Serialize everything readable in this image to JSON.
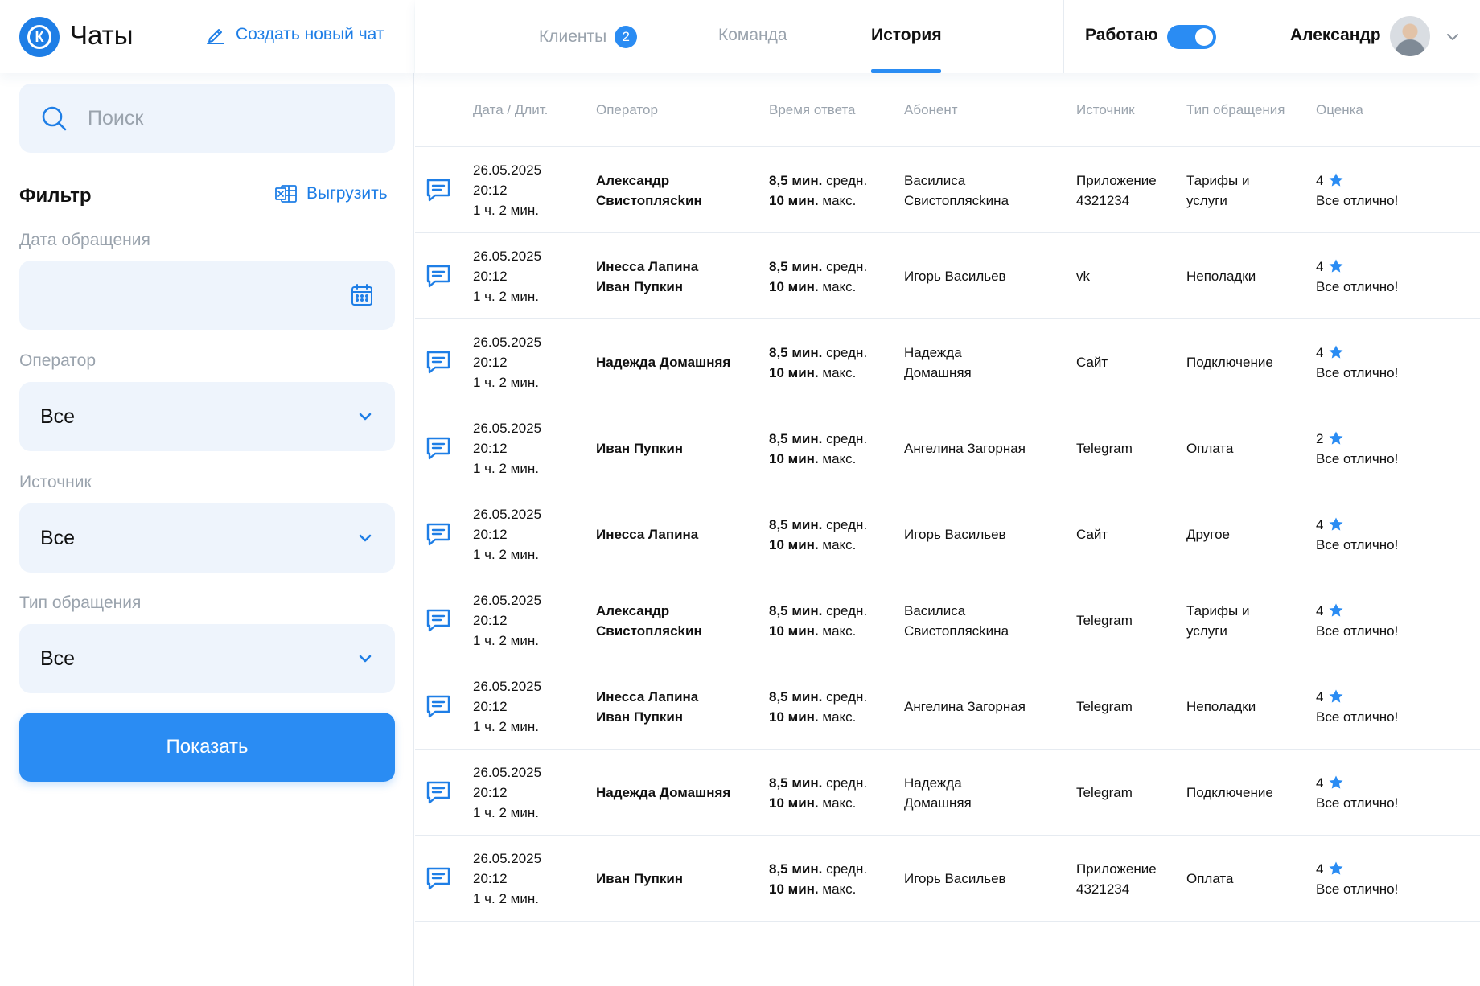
{
  "app": {
    "logo_letter": "К",
    "title": "Чаты",
    "new_chat_label": "Создать новый чат"
  },
  "search": {
    "placeholder": "Поиск"
  },
  "filter": {
    "title": "Фильтр",
    "export_label": "Выгрузить",
    "date_label": "Дата обращения",
    "operator_label": "Оператор",
    "operator_value": "Все",
    "source_label": "Источник",
    "source_value": "Все",
    "type_label": "Тип обращения",
    "type_value": "Все",
    "show_button": "Показать"
  },
  "tabs": [
    {
      "label": "Клиенты",
      "badge": "2"
    },
    {
      "label": "Команда"
    },
    {
      "label": "История",
      "active": true
    }
  ],
  "status": {
    "label": "Работаю",
    "toggle_on": true
  },
  "user": {
    "name": "Александр"
  },
  "colors": {
    "accent": "#2a8cf3",
    "field_bg": "#eef4fc",
    "muted_text": "#9aa3ad"
  },
  "table": {
    "columns": [
      "Дата / Длит.",
      "Оператор",
      "Время ответа",
      "Абонент",
      "Источник",
      "Тип обращения",
      "Оценка"
    ],
    "rows": [
      {
        "date": "26.05.2025",
        "time": "20:12",
        "duration": "1 ч. 2 мин.",
        "operator": [
          "Александр",
          "Свистоплясkин"
        ],
        "resp_avg": "8,5 мин.",
        "resp_avg_label": " средн.",
        "resp_max": "10 мин.",
        "resp_max_label": " макс.",
        "subscriber": [
          "Василиса",
          "Свистоплясkина"
        ],
        "source": [
          "Приложение",
          "4321234"
        ],
        "type": [
          "Тарифы и",
          "услуги"
        ],
        "rating": "4",
        "comment": "Все отлично!"
      },
      {
        "date": "26.05.2025",
        "time": "20:12",
        "duration": "1 ч. 2 мин.",
        "operator": [
          "Инесса Лапина",
          "Иван Пупкин"
        ],
        "resp_avg": "8,5 мин.",
        "resp_avg_label": " средн.",
        "resp_max": "10 мин.",
        "resp_max_label": " макс.",
        "subscriber": [
          "Игорь Васильев"
        ],
        "source": [
          "vk"
        ],
        "type": [
          "Неполадки"
        ],
        "rating": "4",
        "comment": "Все отлично!"
      },
      {
        "date": "26.05.2025",
        "time": "20:12",
        "duration": "1 ч. 2 мин.",
        "operator": [
          "Надежда Домашняя"
        ],
        "resp_avg": "8,5 мин.",
        "resp_avg_label": " средн.",
        "resp_max": "10 мин.",
        "resp_max_label": " макс.",
        "subscriber": [
          "Надежда",
          "Домашняя"
        ],
        "source": [
          "Сайт"
        ],
        "type": [
          "Подключение"
        ],
        "rating": "4",
        "comment": "Все отлично!"
      },
      {
        "date": "26.05.2025",
        "time": "20:12",
        "duration": "1 ч. 2 мин.",
        "operator": [
          "Иван Пупкин"
        ],
        "resp_avg": "8,5 мин.",
        "resp_avg_label": " средн.",
        "resp_max": "10 мин.",
        "resp_max_label": " макс.",
        "subscriber": [
          "Ангелина Загорная"
        ],
        "source": [
          "Telegram"
        ],
        "type": [
          "Оплата"
        ],
        "rating": "2",
        "comment": "Все отлично!"
      },
      {
        "date": "26.05.2025",
        "time": "20:12",
        "duration": "1 ч. 2 мин.",
        "operator": [
          "Инесса Лапина"
        ],
        "resp_avg": "8,5 мин.",
        "resp_avg_label": " средн.",
        "resp_max": "10 мин.",
        "resp_max_label": " макс.",
        "subscriber": [
          "Игорь Васильев"
        ],
        "source": [
          "Сайт"
        ],
        "type": [
          "Другое"
        ],
        "rating": "4",
        "comment": "Все отлично!"
      },
      {
        "date": "26.05.2025",
        "time": "20:12",
        "duration": "1 ч. 2 мин.",
        "operator": [
          "Александр",
          "Свистоплясkин"
        ],
        "resp_avg": "8,5 мин.",
        "resp_avg_label": " средн.",
        "resp_max": "10 мин.",
        "resp_max_label": " макс.",
        "subscriber": [
          "Василиса",
          "Свистоплясkина"
        ],
        "source": [
          "Telegram"
        ],
        "type": [
          "Тарифы и",
          "услуги"
        ],
        "rating": "4",
        "comment": "Все отлично!"
      },
      {
        "date": "26.05.2025",
        "time": "20:12",
        "duration": "1 ч. 2 мин.",
        "operator": [
          "Инесса Лапина",
          "Иван Пупкин"
        ],
        "resp_avg": "8,5 мин.",
        "resp_avg_label": " средн.",
        "resp_max": "10 мин.",
        "resp_max_label": " макс.",
        "subscriber": [
          "Ангелина Загорная"
        ],
        "source": [
          "Telegram"
        ],
        "type": [
          "Неполадки"
        ],
        "rating": "4",
        "comment": "Все отлично!"
      },
      {
        "date": "26.05.2025",
        "time": "20:12",
        "duration": "1 ч. 2 мин.",
        "operator": [
          "Надежда Домашняя"
        ],
        "resp_avg": "8,5 мин.",
        "resp_avg_label": " средн.",
        "resp_max": "10 мин.",
        "resp_max_label": " макс.",
        "subscriber": [
          "Надежда",
          "Домашняя"
        ],
        "source": [
          "Telegram"
        ],
        "type": [
          "Подключение"
        ],
        "rating": "4",
        "comment": "Все отлично!"
      },
      {
        "date": "26.05.2025",
        "time": "20:12",
        "duration": "1 ч. 2 мин.",
        "operator": [
          "Иван Пупкин"
        ],
        "resp_avg": "8,5 мин.",
        "resp_avg_label": " средн.",
        "resp_max": "10 мин.",
        "resp_max_label": " макс.",
        "subscriber": [
          "Игорь Васильев"
        ],
        "source": [
          "Приложение",
          "4321234"
        ],
        "type": [
          "Оплата"
        ],
        "rating": "4",
        "comment": "Все отлично!"
      }
    ]
  }
}
